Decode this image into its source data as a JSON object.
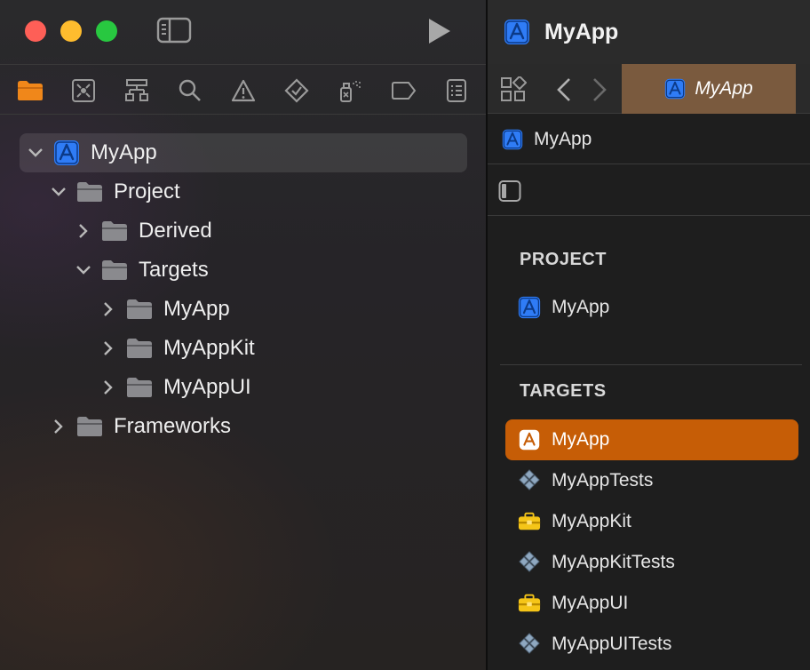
{
  "window": {
    "title": "MyApp"
  },
  "navigator_tabs": [
    {
      "icon": "folder-icon",
      "active": true
    },
    {
      "icon": "source-control-icon"
    },
    {
      "icon": "hierarchy-icon"
    },
    {
      "icon": "search-icon"
    },
    {
      "icon": "warning-icon"
    },
    {
      "icon": "test-icon"
    },
    {
      "icon": "debug-spray-icon"
    },
    {
      "icon": "breakpoint-icon"
    },
    {
      "icon": "report-icon"
    }
  ],
  "tree": {
    "root": {
      "label": "MyApp",
      "expanded": true
    },
    "project": {
      "label": "Project",
      "expanded": true
    },
    "derived": {
      "label": "Derived",
      "expanded": false
    },
    "targets": {
      "label": "Targets",
      "expanded": true
    },
    "target_myapp": {
      "label": "MyApp"
    },
    "target_myappkit": {
      "label": "MyAppKit"
    },
    "target_myappui": {
      "label": "MyAppUI"
    },
    "frameworks": {
      "label": "Frameworks",
      "expanded": false
    }
  },
  "editor": {
    "active_tab": "MyApp",
    "jumpbar": "MyApp"
  },
  "inspector": {
    "project_header": "PROJECT",
    "project_item": "MyApp",
    "targets_header": "TARGETS",
    "targets": [
      {
        "label": "MyApp",
        "icon": "app-icon",
        "selected": true
      },
      {
        "label": "MyAppTests",
        "icon": "test-bundle-icon"
      },
      {
        "label": "MyAppKit",
        "icon": "framework-toolbox-icon"
      },
      {
        "label": "MyAppKitTests",
        "icon": "test-bundle-icon"
      },
      {
        "label": "MyAppUI",
        "icon": "framework-toolbox-icon"
      },
      {
        "label": "MyAppUITests",
        "icon": "test-bundle-icon"
      }
    ]
  },
  "colors": {
    "accent_selected": "#c65d06",
    "active_tab_bg": "#7a5a3e",
    "app_icon_blue": "#2f7cf6",
    "toolbox_yellow": "#f5c518",
    "nav_active_orange": "#f0871a"
  }
}
